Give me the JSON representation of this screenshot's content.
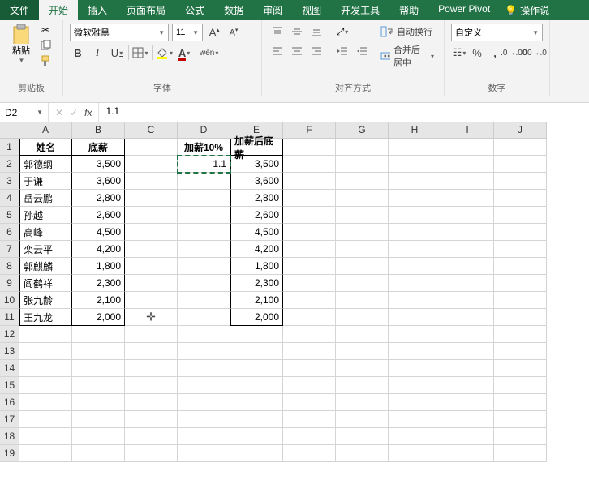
{
  "tabs": {
    "file": "文件",
    "home": "开始",
    "insert": "插入",
    "layout": "页面布局",
    "formula": "公式",
    "data": "数据",
    "review": "审阅",
    "view": "视图",
    "dev": "开发工具",
    "help": "帮助",
    "pivot": "Power Pivot",
    "operate": "操作说"
  },
  "ribbon": {
    "paste": "粘贴",
    "clipboard": "剪贴板",
    "font_name": "微软雅黑",
    "font_size": "11",
    "bold": "B",
    "italic": "I",
    "underline": "U",
    "wen": "wén",
    "font_label": "字体",
    "wrap": "自动换行",
    "merge": "合并后居中",
    "align_label": "对齐方式",
    "format": "自定义",
    "number_label": "数字"
  },
  "namebox": "D2",
  "formula": "1.1",
  "cols": [
    "A",
    "B",
    "C",
    "D",
    "E",
    "F",
    "G",
    "H",
    "I",
    "J"
  ],
  "rows": [
    "1",
    "2",
    "3",
    "4",
    "5",
    "6",
    "7",
    "8",
    "9",
    "10",
    "11",
    "12",
    "13",
    "14",
    "15",
    "16",
    "17",
    "18",
    "19"
  ],
  "headers": {
    "a": "姓名",
    "b": "底薪",
    "d": "加薪10%",
    "e": "加薪后底薪"
  },
  "data_rows": [
    {
      "a": "郭德纲",
      "b": "3,500",
      "d": "1.1",
      "e": "3,500"
    },
    {
      "a": "于谦",
      "b": "3,600",
      "d": "",
      "e": "3,600"
    },
    {
      "a": "岳云鹏",
      "b": "2,800",
      "d": "",
      "e": "2,800"
    },
    {
      "a": "孙越",
      "b": "2,600",
      "d": "",
      "e": "2,600"
    },
    {
      "a": "高峰",
      "b": "4,500",
      "d": "",
      "e": "4,500"
    },
    {
      "a": "栾云平",
      "b": "4,200",
      "d": "",
      "e": "4,200"
    },
    {
      "a": "郭麒麟",
      "b": "1,800",
      "d": "",
      "e": "1,800"
    },
    {
      "a": "阎鹤祥",
      "b": "2,300",
      "d": "",
      "e": "2,300"
    },
    {
      "a": "张九龄",
      "b": "2,100",
      "d": "",
      "e": "2,100"
    },
    {
      "a": "王九龙",
      "b": "2,000",
      "d": "",
      "e": "2,000"
    }
  ]
}
